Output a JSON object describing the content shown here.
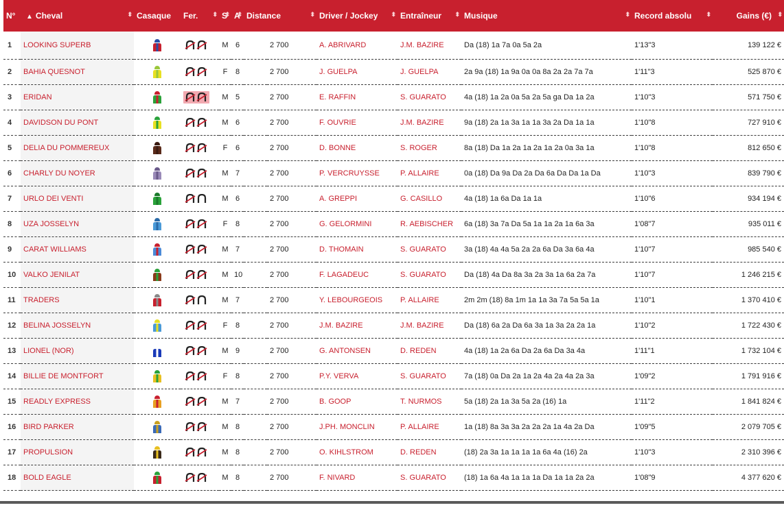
{
  "headers": {
    "num": "N°",
    "cheval": "Cheval",
    "casaque": "Casaque",
    "fer": "Fer.",
    "sexe": "S",
    "age": "A",
    "distance": "Distance",
    "driver": "Driver / Jockey",
    "entraineur": "Entraîneur",
    "musique": "Musique",
    "record": "Record absolu",
    "gains": "Gains (€)"
  },
  "rows": [
    {
      "num": "1",
      "cheval": "LOOKING SUPERB",
      "sexe": "M",
      "age": "6",
      "distance": "2 700",
      "driver": "A. ABRIVARD",
      "entraineur": "J.M. BAZIRE",
      "musique": "Da (18) 1a 7a 0a 5a 2a",
      "record": "1'13\"3",
      "gains": "139 122 €",
      "colors": [
        "#c8202e",
        "#2a4ea8"
      ],
      "fer": "DD",
      "highlight": false
    },
    {
      "num": "2",
      "cheval": "BAHIA QUESNOT",
      "sexe": "F",
      "age": "8",
      "distance": "2 700",
      "driver": "J. GUELPA",
      "entraineur": "J. GUELPA",
      "musique": "2a 9a (18) 1a 9a 0a 0a 8a 2a 2a 7a 7a",
      "record": "1'11\"3",
      "gains": "525 870 €",
      "colors": [
        "#e8e022",
        "#9ac73a"
      ],
      "fer": "DD",
      "highlight": false
    },
    {
      "num": "3",
      "cheval": "ERIDAN",
      "sexe": "M",
      "age": "5",
      "distance": "2 700",
      "driver": "E. RAFFIN",
      "entraineur": "S. GUARATO",
      "musique": "4a (18) 1a 2a 0a 5a 2a 5a ga Da 1a 2a",
      "record": "1'10\"3",
      "gains": "571 750 €",
      "colors": [
        "#2aa23a",
        "#c8202e"
      ],
      "fer": "DD",
      "highlight": true
    },
    {
      "num": "4",
      "cheval": "DAVIDSON DU PONT",
      "sexe": "M",
      "age": "6",
      "distance": "2 700",
      "driver": "F. OUVRIE",
      "entraineur": "J.M. BAZIRE",
      "musique": "9a (18) 2a 1a 3a 1a 1a 3a 2a Da 1a 1a",
      "record": "1'10\"8",
      "gains": "727 910 €",
      "colors": [
        "#e8e022",
        "#2aa23a"
      ],
      "fer": "DD",
      "highlight": false
    },
    {
      "num": "5",
      "cheval": "DELIA DU POMMEREUX",
      "sexe": "F",
      "age": "6",
      "distance": "2 700",
      "driver": "D. BONNE",
      "entraineur": "S. ROGER",
      "musique": "8a (18) Da 1a 2a 1a 2a 1a 2a 0a 3a 1a",
      "record": "1'10\"8",
      "gains": "812 650 €",
      "colors": [
        "#5a2a1a",
        "#3a1a10"
      ],
      "fer": "DD",
      "highlight": false
    },
    {
      "num": "6",
      "cheval": "CHARLY DU NOYER",
      "sexe": "M",
      "age": "7",
      "distance": "2 700",
      "driver": "P. VERCRUYSSE",
      "entraineur": "P. ALLAIRE",
      "musique": "0a (18) Da 9a Da 2a Da 6a Da Da 1a Da",
      "record": "1'10\"3",
      "gains": "839 790 €",
      "colors": [
        "#9a8ab8",
        "#6a5a8a"
      ],
      "fer": "DD",
      "highlight": false
    },
    {
      "num": "7",
      "cheval": "URLO DEI VENTI",
      "sexe": "M",
      "age": "6",
      "distance": "2 700",
      "driver": "A. GREPPI",
      "entraineur": "G. CASILLO",
      "musique": "4a (18) 1a 6a Da 1a 1a",
      "record": "1'10\"6",
      "gains": "934 194 €",
      "colors": [
        "#2aa23a",
        "#1a7a2a"
      ],
      "fer": "DP",
      "highlight": false
    },
    {
      "num": "8",
      "cheval": "UZA JOSSELYN",
      "sexe": "F",
      "age": "8",
      "distance": "2 700",
      "driver": "G. GELORMINI",
      "entraineur": "R. AEBISCHER",
      "musique": "6a (18) 3a 7a Da 5a 1a 1a 2a 1a 6a 3a",
      "record": "1'08\"7",
      "gains": "935 011 €",
      "colors": [
        "#4a9ad8",
        "#2a6aa8"
      ],
      "fer": "DD",
      "highlight": false
    },
    {
      "num": "9",
      "cheval": "CARAT WILLIAMS",
      "sexe": "M",
      "age": "7",
      "distance": "2 700",
      "driver": "D. THOMAIN",
      "entraineur": "S. GUARATO",
      "musique": "3a (18) 4a 4a 5a 2a 2a 6a Da 3a 6a 4a",
      "record": "1'10\"7",
      "gains": "985 540 €",
      "colors": [
        "#4a8ad8",
        "#c8202e"
      ],
      "fer": "DD",
      "highlight": false
    },
    {
      "num": "10",
      "cheval": "VALKO JENILAT",
      "sexe": "M",
      "age": "10",
      "distance": "2 700",
      "driver": "F. LAGADEUC",
      "entraineur": "S. GUARATO",
      "musique": "Da (18) 4a Da 8a 3a 2a 3a 1a 6a 2a 7a",
      "record": "1'10\"7",
      "gains": "1 246 215 €",
      "colors": [
        "#8a3a1a",
        "#2aa23a"
      ],
      "fer": "DD",
      "highlight": false
    },
    {
      "num": "11",
      "cheval": "TRADERS",
      "sexe": "M",
      "age": "7",
      "distance": "2 700",
      "driver": "Y. LEBOURGEOIS",
      "entraineur": "P. ALLAIRE",
      "musique": "2m 2m (18) 8a 1m 1a 1a 3a 7a 5a 5a 1a",
      "record": "1'10\"1",
      "gains": "1 370 410 €",
      "colors": [
        "#c8202e",
        "#8a8a8a"
      ],
      "fer": "DP",
      "highlight": false
    },
    {
      "num": "12",
      "cheval": "BELINA JOSSELYN",
      "sexe": "F",
      "age": "8",
      "distance": "2 700",
      "driver": "J.M. BAZIRE",
      "entraineur": "J.M. BAZIRE",
      "musique": "Da (18) 6a 2a Da 6a 3a 1a 3a 2a 2a 1a",
      "record": "1'10\"2",
      "gains": "1 722 430 €",
      "colors": [
        "#4a9ad8",
        "#e8e022"
      ],
      "fer": "DD",
      "highlight": false
    },
    {
      "num": "13",
      "cheval": "LIONEL (NOR)",
      "sexe": "M",
      "age": "9",
      "distance": "2 700",
      "driver": "G. ANTONSEN",
      "entraineur": "D. REDEN",
      "musique": "4a (18) 1a 2a 6a Da 2a 6a Da 3a 4a",
      "record": "1'11\"1",
      "gains": "1 732 104 €",
      "colors": [
        "#1a3ab8",
        "#ffffff"
      ],
      "fer": "DD",
      "highlight": false
    },
    {
      "num": "14",
      "cheval": "BILLIE DE MONTFORT",
      "sexe": "F",
      "age": "8",
      "distance": "2 700",
      "driver": "P.Y. VERVA",
      "entraineur": "S. GUARATO",
      "musique": "7a (18) 0a Da 2a 1a 2a 4a 2a 4a 2a 3a",
      "record": "1'09\"2",
      "gains": "1 791 916 €",
      "colors": [
        "#e8c022",
        "#2aa23a"
      ],
      "fer": "DD",
      "highlight": false
    },
    {
      "num": "15",
      "cheval": "READLY EXPRESS",
      "sexe": "M",
      "age": "7",
      "distance": "2 700",
      "driver": "B. GOOP",
      "entraineur": "T. NURMOS",
      "musique": "5a (18) 2a 1a 3a 5a 2a (16) 1a",
      "record": "1'11\"2",
      "gains": "1 841 824 €",
      "colors": [
        "#e8a022",
        "#c8202e"
      ],
      "fer": "DD",
      "highlight": false
    },
    {
      "num": "16",
      "cheval": "BIRD PARKER",
      "sexe": "M",
      "age": "8",
      "distance": "2 700",
      "driver": "J.PH. MONCLIN",
      "entraineur": "P. ALLAIRE",
      "musique": "1a (18) 8a 3a 3a 2a 2a 2a 1a 4a 2a Da",
      "record": "1'09\"5",
      "gains": "2 079 705 €",
      "colors": [
        "#3a6ab8",
        "#c8a022"
      ],
      "fer": "DD",
      "highlight": false
    },
    {
      "num": "17",
      "cheval": "PROPULSION",
      "sexe": "M",
      "age": "8",
      "distance": "2 700",
      "driver": "O. KIHLSTROM",
      "entraineur": "D. REDEN",
      "musique": "(18) 2a 3a 1a 1a 1a 1a 6a 4a (16) 2a",
      "record": "1'10\"3",
      "gains": "2 310 396 €",
      "colors": [
        "#3a2a1a",
        "#e8c022"
      ],
      "fer": "DD",
      "highlight": false
    },
    {
      "num": "18",
      "cheval": "BOLD EAGLE",
      "sexe": "M",
      "age": "8",
      "distance": "2 700",
      "driver": "F. NIVARD",
      "entraineur": "S. GUARATO",
      "musique": "(18) 1a 6a 4a 1a 1a 1a Da 1a 1a 2a 2a",
      "record": "1'08\"9",
      "gains": "4 377 620 €",
      "colors": [
        "#c8202e",
        "#2aa23a"
      ],
      "fer": "DD",
      "highlight": false
    }
  ],
  "icons": {
    "sort": "sort-arrows-icon",
    "sort_active": "sort-ascending-icon",
    "jockey": "jockey-silk-icon",
    "horseshoe_crossed": "horseshoe-crossed-icon",
    "horseshoe": "horseshoe-icon"
  },
  "colors": {
    "header_bg": "#c8202e",
    "accent": "#c8202e",
    "highlight": "#f2a9b0"
  }
}
